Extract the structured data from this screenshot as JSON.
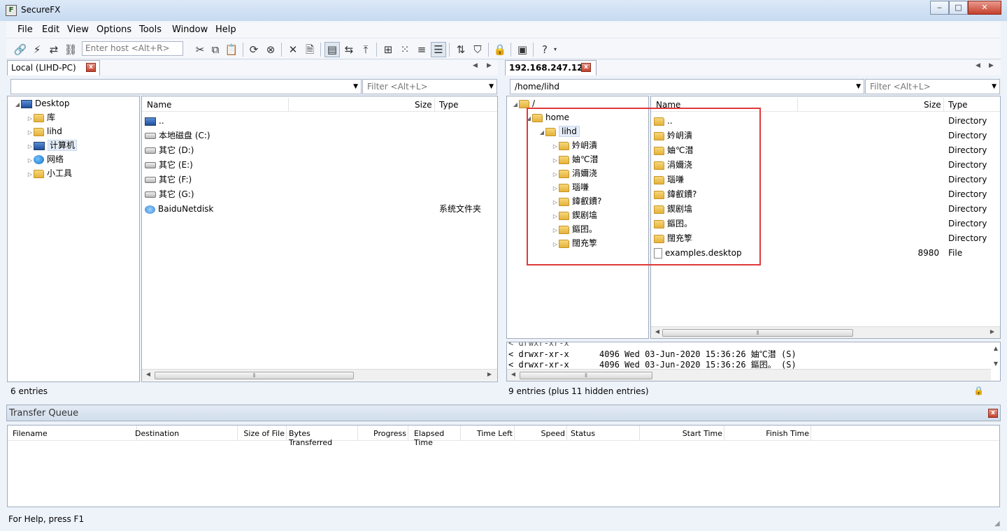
{
  "window": {
    "title": "SecureFX",
    "min": "‒",
    "max": "□",
    "close": "✕"
  },
  "menu": [
    "File",
    "Edit",
    "View",
    "Options",
    "Tools",
    "Window",
    "Help"
  ],
  "toolbar": {
    "host_placeholder": "Enter host <Alt+R>"
  },
  "local": {
    "tab": "Local (LIHD-PC)",
    "path": "",
    "filter_placeholder": "Filter <Alt+L>",
    "tree": [
      {
        "label": "Desktop",
        "icon": "monitor-icon",
        "expander": "◢",
        "indent": 0
      },
      {
        "label": "库",
        "icon": "folder-icon",
        "expander": "▷",
        "indent": 1
      },
      {
        "label": "lihd",
        "icon": "folder-icon",
        "expander": "▷",
        "indent": 1
      },
      {
        "label": "计算机",
        "icon": "computer-icon",
        "expander": "▷",
        "indent": 1
      },
      {
        "label": "网络",
        "icon": "network-icon",
        "expander": "▷",
        "indent": 1
      },
      {
        "label": "小工具",
        "icon": "folder-icon",
        "expander": "▷",
        "indent": 1
      }
    ],
    "columns": {
      "name": "Name",
      "size": "Size",
      "type": "Type"
    },
    "files": [
      {
        "name": "..",
        "icon": "monitor-icon",
        "size": "",
        "type": ""
      },
      {
        "name": "本地磁盘 (C:)",
        "icon": "drive-icon",
        "size": "",
        "type": ""
      },
      {
        "name": "其它 (D:)",
        "icon": "drive-icon",
        "size": "",
        "type": ""
      },
      {
        "name": "其它 (E:)",
        "icon": "drive-icon",
        "size": "",
        "type": ""
      },
      {
        "name": "其它 (F:)",
        "icon": "drive-icon",
        "size": "",
        "type": ""
      },
      {
        "name": "其它 (G:)",
        "icon": "drive-icon",
        "size": "",
        "type": ""
      },
      {
        "name": "BaiduNetdisk",
        "icon": "cloud-icon",
        "size": "",
        "type": "系统文件夹"
      }
    ],
    "status": "6 entries"
  },
  "remote": {
    "tab": "192.168.247.129",
    "path": "/home/lihd",
    "filter_placeholder": "Filter <Alt+L>",
    "tree": [
      {
        "label": "/",
        "expander": "◢",
        "indent": 0
      },
      {
        "label": "home",
        "expander": "◢",
        "indent": 1
      },
      {
        "label": "lihd",
        "expander": "◢",
        "indent": 2
      },
      {
        "label": "妗岄潰",
        "expander": "▷",
        "indent": 3
      },
      {
        "label": "妯℃澘",
        "expander": "▷",
        "indent": 3
      },
      {
        "label": "涓嬭浇",
        "expander": "▷",
        "indent": 3
      },
      {
        "label": "瑙嗛",
        "expander": "▷",
        "indent": 3
      },
      {
        "label": "鍏叡鐨?",
        "expander": "▷",
        "indent": 3
      },
      {
        "label": "鍥剧墖",
        "expander": "▷",
        "indent": 3
      },
      {
        "label": "鏂囨。",
        "expander": "▷",
        "indent": 3
      },
      {
        "label": "闊充箰",
        "expander": "▷",
        "indent": 3
      }
    ],
    "columns": {
      "name": "Name",
      "size": "Size",
      "type": "Type"
    },
    "files": [
      {
        "name": "..",
        "icon": "folder-icon",
        "size": "",
        "type": "Directory"
      },
      {
        "name": "妗岄潰",
        "icon": "folder-icon",
        "size": "",
        "type": "Directory"
      },
      {
        "name": "妯℃澘",
        "icon": "folder-icon",
        "size": "",
        "type": "Directory"
      },
      {
        "name": "涓嬭浇",
        "icon": "folder-icon",
        "size": "",
        "type": "Directory"
      },
      {
        "name": "瑙嗛",
        "icon": "folder-icon",
        "size": "",
        "type": "Directory"
      },
      {
        "name": "鍏叡鐨?",
        "icon": "folder-icon",
        "size": "",
        "type": "Directory"
      },
      {
        "name": "鍥剧墖",
        "icon": "folder-icon",
        "size": "",
        "type": "Directory"
      },
      {
        "name": "鏂囨。",
        "icon": "folder-icon",
        "size": "",
        "type": "Directory"
      },
      {
        "name": "闊充箰",
        "icon": "folder-icon",
        "size": "",
        "type": "Directory"
      },
      {
        "name": "examples.desktop",
        "icon": "file-icon",
        "size": "8980",
        "type": "File"
      }
    ],
    "log": [
      "< drwxr-xr-x      4096 Wed 03-Jun-2020 15:36:26 妯℃澘 (S)",
      "< drwxr-xr-x      4096 Wed 03-Jun-2020 15:36:26 鏂囨。 (S)"
    ],
    "status": "9 entries (plus 11 hidden entries)"
  },
  "transfer_queue": {
    "title": "Transfer Queue",
    "columns": [
      "Filename",
      "Destination",
      "Size of File",
      "Bytes Transferred",
      "Progress",
      "Elapsed Time",
      "Time Left",
      "Speed",
      "Status",
      "Start Time",
      "Finish Time"
    ]
  },
  "footer": {
    "help": "For Help, press F1"
  },
  "colors": {
    "highlight": "#e0393a",
    "chrome": "#eef3fa",
    "folder": "#e5b23b"
  }
}
